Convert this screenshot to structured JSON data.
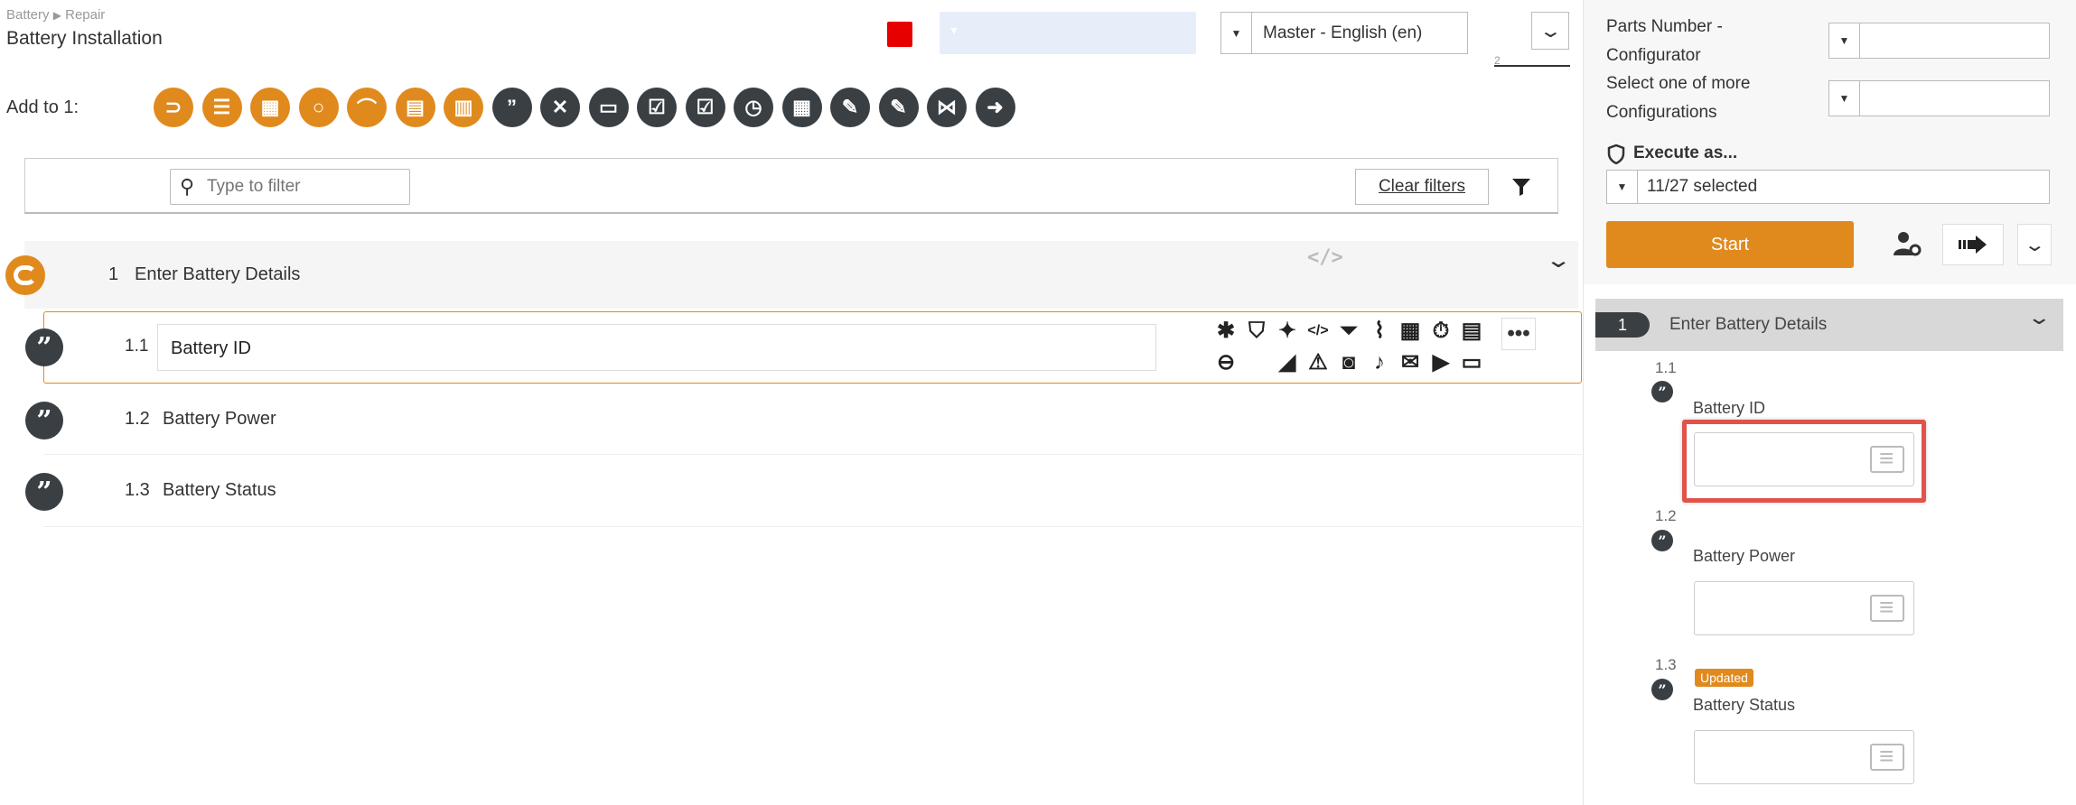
{
  "breadcrumb": {
    "root": "Battery",
    "separator": "▶",
    "child": "Repair"
  },
  "page_title": "Battery Installation",
  "language_select": {
    "value": "Master - English (en)"
  },
  "revision_counter": "2",
  "add_to": {
    "label": "Add to 1:"
  },
  "toolbar_icons": [
    "loop-icon",
    "numbered-list-icon",
    "table-icon",
    "circle-icon",
    "link-icon",
    "checklist-clipboard-icon",
    "film-icon",
    "quote-icon",
    "cross-check-icon",
    "input-box-icon",
    "checklist-icon",
    "checkbox-icon",
    "clock-icon",
    "calculator-icon",
    "tools-icon",
    "edit-icon",
    "share-icon",
    "arrow-right-icon"
  ],
  "filter": {
    "placeholder": "Type to filter",
    "clear_label": "Clear filters"
  },
  "section": {
    "number": "1",
    "title": "Enter Battery Details"
  },
  "steps": [
    {
      "number": "1.1",
      "value": "Battery ID"
    },
    {
      "number": "1.2",
      "label": "Battery Power"
    },
    {
      "number": "1.3",
      "label": "Battery Status"
    }
  ],
  "sidebar": {
    "parts_number_label_1": "Parts Number -",
    "parts_number_label_2": "Configurator",
    "configurations_label_1": "Select one of more",
    "configurations_label_2": "Configurations",
    "execute_as_label": "Execute as...",
    "execute_as_value": "11/27 selected",
    "start_label": "Start"
  },
  "preview": {
    "section_number": "1",
    "section_title": "Enter Battery Details",
    "items": [
      {
        "number": "1.1",
        "label": "Battery ID",
        "badge": ""
      },
      {
        "number": "1.2",
        "label": "Battery Power",
        "badge": ""
      },
      {
        "number": "1.3",
        "label": "Battery Status",
        "badge": "Updated"
      }
    ]
  },
  "colors": {
    "accent": "#e08a1e",
    "dark": "#3a3f44",
    "stop": "#e60000",
    "highlight": "#e0534a"
  }
}
